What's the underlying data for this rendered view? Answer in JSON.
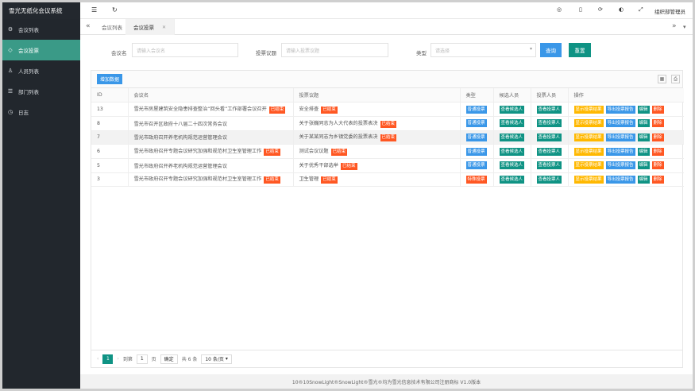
{
  "app": {
    "title": "雪光无纸化会议系统"
  },
  "sidebar": {
    "items": [
      {
        "label": "会议列表",
        "icon": "gear-icon"
      },
      {
        "label": "会议投票",
        "icon": "tag-icon"
      },
      {
        "label": "人员列表",
        "icon": "user-icon"
      },
      {
        "label": "部门列表",
        "icon": "list-icon"
      },
      {
        "label": "日志",
        "icon": "clock-icon"
      }
    ]
  },
  "topbar": {
    "user": "组织部管理员"
  },
  "tabs": [
    {
      "label": "会议列表"
    },
    {
      "label": "会议投票"
    }
  ],
  "filter": {
    "meeting_label": "会议名",
    "meeting_placeholder": "请输入会议名",
    "topic_label": "投票议题",
    "topic_placeholder": "请输入投票议题",
    "type_label": "类型",
    "type_placeholder": "请选择",
    "search_label": "查询",
    "reset_label": "重置"
  },
  "toolbar": {
    "add_label": "增加数据"
  },
  "table": {
    "headers": [
      "ID",
      "会议名",
      "投票议题",
      "类型",
      "候选人员",
      "投票人员",
      "操作"
    ],
    "rows": [
      {
        "id": "13",
        "meeting": "雪光市房屋建筑安全隐患排查整治“回头看”工作部署会议召开",
        "meeting_tag": "已结束",
        "topic": "安全排查",
        "topic_tag": "已结束",
        "type": "普通投票",
        "type_color": "#3a97e8",
        "candidates": "查看候选人",
        "voters": "查看投票人"
      },
      {
        "id": "8",
        "meeting": "雪光市召开区政府十八届二十四次常务会议",
        "meeting_tag": "",
        "topic": "关于张巍同志为人大代表的投票表决",
        "topic_tag": "已结束",
        "type": "普通投票",
        "type_color": "#3a97e8",
        "candidates": "查看候选人",
        "voters": "查看投票人"
      },
      {
        "id": "7",
        "meeting": "雪光市政府召开养老机构规范运营管理会议",
        "meeting_tag": "",
        "topic": "关于某某同志为乡镇党委的投票表决",
        "topic_tag": "已结束",
        "type": "普通投票",
        "type_color": "#3a97e8",
        "candidates": "查看候选人",
        "voters": "查看投票人"
      },
      {
        "id": "6",
        "meeting": "雪光市政府召开专题会议研究加强和规范村卫生室管理工作",
        "meeting_tag": "已结束",
        "topic": "测试会议议题",
        "topic_tag": "已结束",
        "type": "普通投票",
        "type_color": "#3a97e8",
        "candidates": "查看候选人",
        "voters": "查看投票人"
      },
      {
        "id": "5",
        "meeting": "雪光市政府召开养老机构规范运营管理会议",
        "meeting_tag": "",
        "topic": "关于优秀干部选举",
        "topic_tag": "已结束",
        "type": "普通投票",
        "type_color": "#3a97e8",
        "candidates": "查看候选人",
        "voters": "查看投票人"
      },
      {
        "id": "3",
        "meeting": "雪光市政府召开专题会议研究加强和规范村卫生室管理工作",
        "meeting_tag": "已结束",
        "topic": "卫生管理",
        "topic_tag": "已结束",
        "type": "特殊投票",
        "type_color": "#ff5722",
        "candidates": "查看候选人",
        "voters": "查看投票人"
      }
    ],
    "actions": {
      "show": "显示投票结果",
      "export": "导出投票报告",
      "edit": "编辑",
      "delete": "删除"
    }
  },
  "pager": {
    "current_page": "1",
    "goto_prefix": "到第",
    "goto_value": "1",
    "goto_suffix": "页",
    "confirm": "确定",
    "total": "共 6 条",
    "per_page": "10 条/页"
  },
  "footer": {
    "text": "10®10SnowLight®SnowLight®雪光®均为雪光信息技术有限公司注册商标 V1.0版本"
  },
  "colors": {
    "sidebar_bg": "#22272d",
    "accent": "#3a9a87",
    "primary": "#3a97e8",
    "danger": "#ff5722",
    "success": "#0f9384",
    "warning": "#ffb800"
  }
}
